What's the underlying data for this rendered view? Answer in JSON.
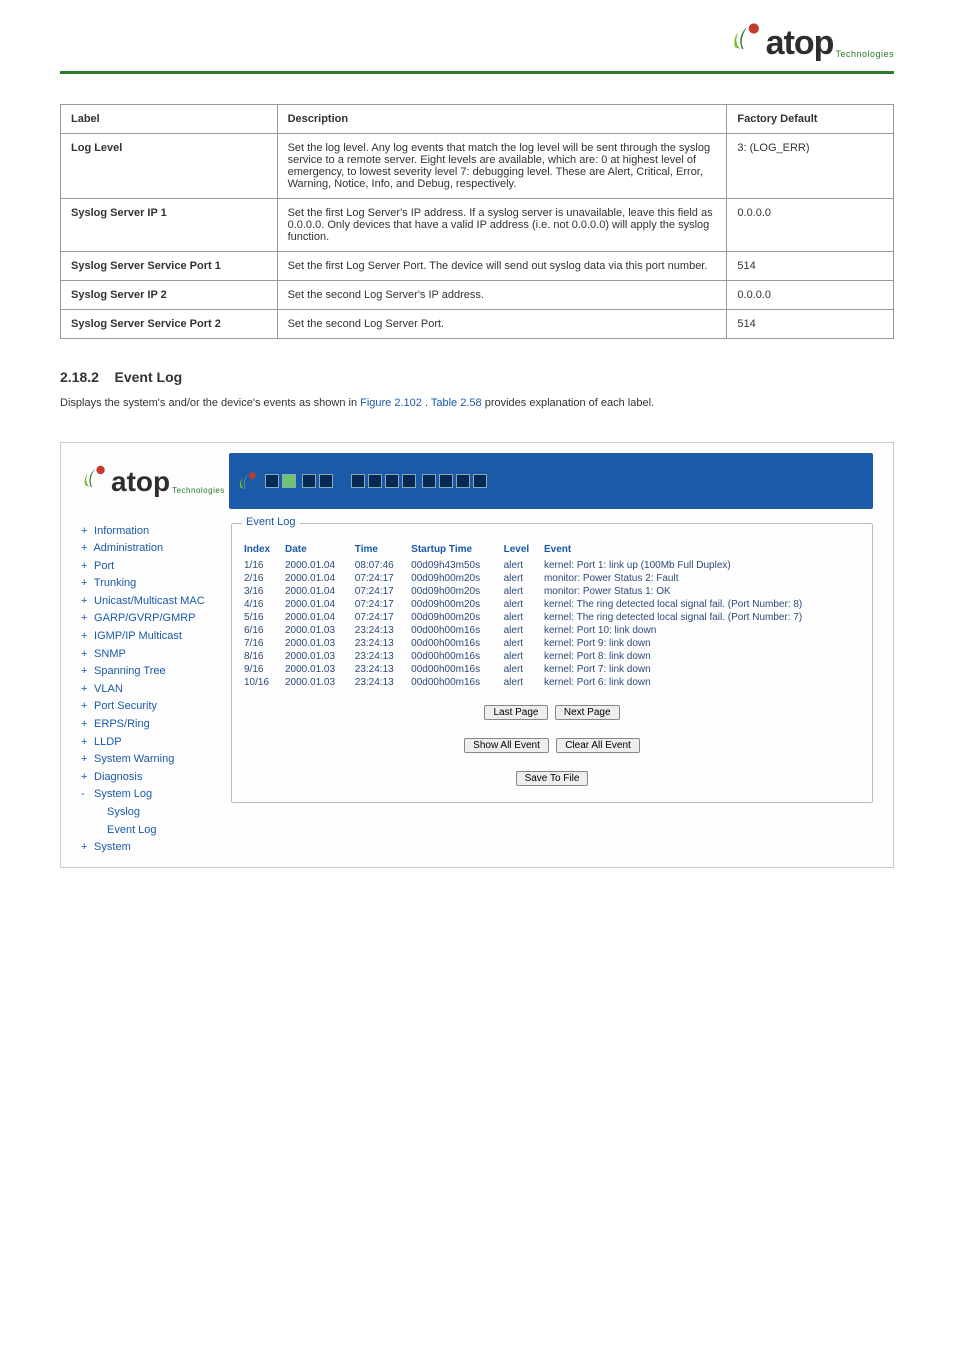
{
  "logo": {
    "brand": "atop",
    "tagline": "Technologies"
  },
  "params_table": {
    "headers": [
      "Label",
      "Description",
      "Factory Default"
    ],
    "rows": [
      {
        "label": "Log Level",
        "desc": "Set the log level. Any log events that match the log level will be sent through the syslog service to a remote server. Eight levels are available, which are: 0 at highest level of emergency, to lowest severity level 7: debugging level. These are Alert, Critical, Error, Warning, Notice, Info, and Debug, respectively.",
        "val": "3: (LOG_ERR)"
      },
      {
        "label": "Syslog Server IP 1",
        "desc": "Set the first Log Server's IP address. If a syslog server is unavailable, leave this field as 0.0.0.0. Only devices that have a valid IP address (i.e. not 0.0.0.0) will apply the syslog function.",
        "val": "0.0.0.0"
      },
      {
        "label": "Syslog Server Service Port 1",
        "desc": "Set the first Log Server Port. The device will send out syslog data via this port number.",
        "val": "514"
      },
      {
        "label": "Syslog Server IP 2",
        "desc": "Set the second Log Server's IP address.",
        "val": "0.0.0.0"
      },
      {
        "label": "Syslog Server Service Port 2",
        "desc": "Set the second Log Server Port.",
        "val": "514"
      }
    ]
  },
  "section": {
    "number": "2.18.2",
    "title": "Event Log",
    "body_prefix": "Displays the system's and/or the device's events as shown in ",
    "fig_ref": "Figure 2.102",
    "body_mid": ". ",
    "tbl_ref": "Table 2.58",
    "body_suffix": " provides explanation of each label."
  },
  "screenshot": {
    "nav": {
      "items": [
        {
          "label": "Information",
          "sym": "+"
        },
        {
          "label": "Administration",
          "sym": "+"
        },
        {
          "label": "Port",
          "sym": "+"
        },
        {
          "label": "Trunking",
          "sym": "+"
        },
        {
          "label": "Unicast/Multicast MAC",
          "sym": "+"
        },
        {
          "label": "GARP/GVRP/GMRP",
          "sym": "+"
        },
        {
          "label": "IGMP/IP Multicast",
          "sym": "+"
        },
        {
          "label": "SNMP",
          "sym": "+"
        },
        {
          "label": "Spanning Tree",
          "sym": "+"
        },
        {
          "label": "VLAN",
          "sym": "+"
        },
        {
          "label": "Port Security",
          "sym": "+"
        },
        {
          "label": "ERPS/Ring",
          "sym": "+"
        },
        {
          "label": "LLDP",
          "sym": "+"
        },
        {
          "label": "System Warning",
          "sym": "+"
        },
        {
          "label": "Diagnosis",
          "sym": "+"
        },
        {
          "label": "System Log",
          "sym": "-"
        }
      ],
      "subs": [
        "Syslog",
        "Event Log"
      ],
      "after": {
        "label": "System",
        "sym": "+"
      }
    },
    "legend": "Event Log",
    "event_table": {
      "headers": [
        "Index",
        "Date",
        "Time",
        "Startup Time",
        "Level",
        "Event"
      ],
      "rows": [
        {
          "index": "1/16",
          "date": "2000.01.04",
          "time": "08:07:46",
          "startup": "00d09h43m50s",
          "level": "alert",
          "event": "kernel: Port 1: link up (100Mb Full Duplex)"
        },
        {
          "index": "2/16",
          "date": "2000.01.04",
          "time": "07:24:17",
          "startup": "00d09h00m20s",
          "level": "alert",
          "event": "monitor: Power Status 2: Fault"
        },
        {
          "index": "3/16",
          "date": "2000.01.04",
          "time": "07:24:17",
          "startup": "00d09h00m20s",
          "level": "alert",
          "event": "monitor: Power Status 1: OK"
        },
        {
          "index": "4/16",
          "date": "2000.01.04",
          "time": "07:24:17",
          "startup": "00d09h00m20s",
          "level": "alert",
          "event": "kernel: The ring detected local signal fail. (Port Number: 8)"
        },
        {
          "index": "5/16",
          "date": "2000.01.04",
          "time": "07:24:17",
          "startup": "00d09h00m20s",
          "level": "alert",
          "event": "kernel: The ring detected local signal fail. (Port Number: 7)"
        },
        {
          "index": "6/16",
          "date": "2000.01.03",
          "time": "23:24:13",
          "startup": "00d00h00m16s",
          "level": "alert",
          "event": "kernel: Port 10: link down"
        },
        {
          "index": "7/16",
          "date": "2000.01.03",
          "time": "23:24:13",
          "startup": "00d00h00m16s",
          "level": "alert",
          "event": "kernel: Port 9: link down"
        },
        {
          "index": "8/16",
          "date": "2000.01.03",
          "time": "23:24:13",
          "startup": "00d00h00m16s",
          "level": "alert",
          "event": "kernel: Port 8: link down"
        },
        {
          "index": "9/16",
          "date": "2000.01.03",
          "time": "23:24:13",
          "startup": "00d00h00m16s",
          "level": "alert",
          "event": "kernel: Port 7: link down"
        },
        {
          "index": "10/16",
          "date": "2000.01.03",
          "time": "23:24:13",
          "startup": "00d00h00m16s",
          "level": "alert",
          "event": "kernel: Port 6: link down"
        }
      ]
    },
    "buttons": {
      "last_page": "Last Page",
      "next_page": "Next Page",
      "show_all": "Show All Event",
      "clear_all": "Clear All Event",
      "save_file": "Save To File"
    }
  }
}
